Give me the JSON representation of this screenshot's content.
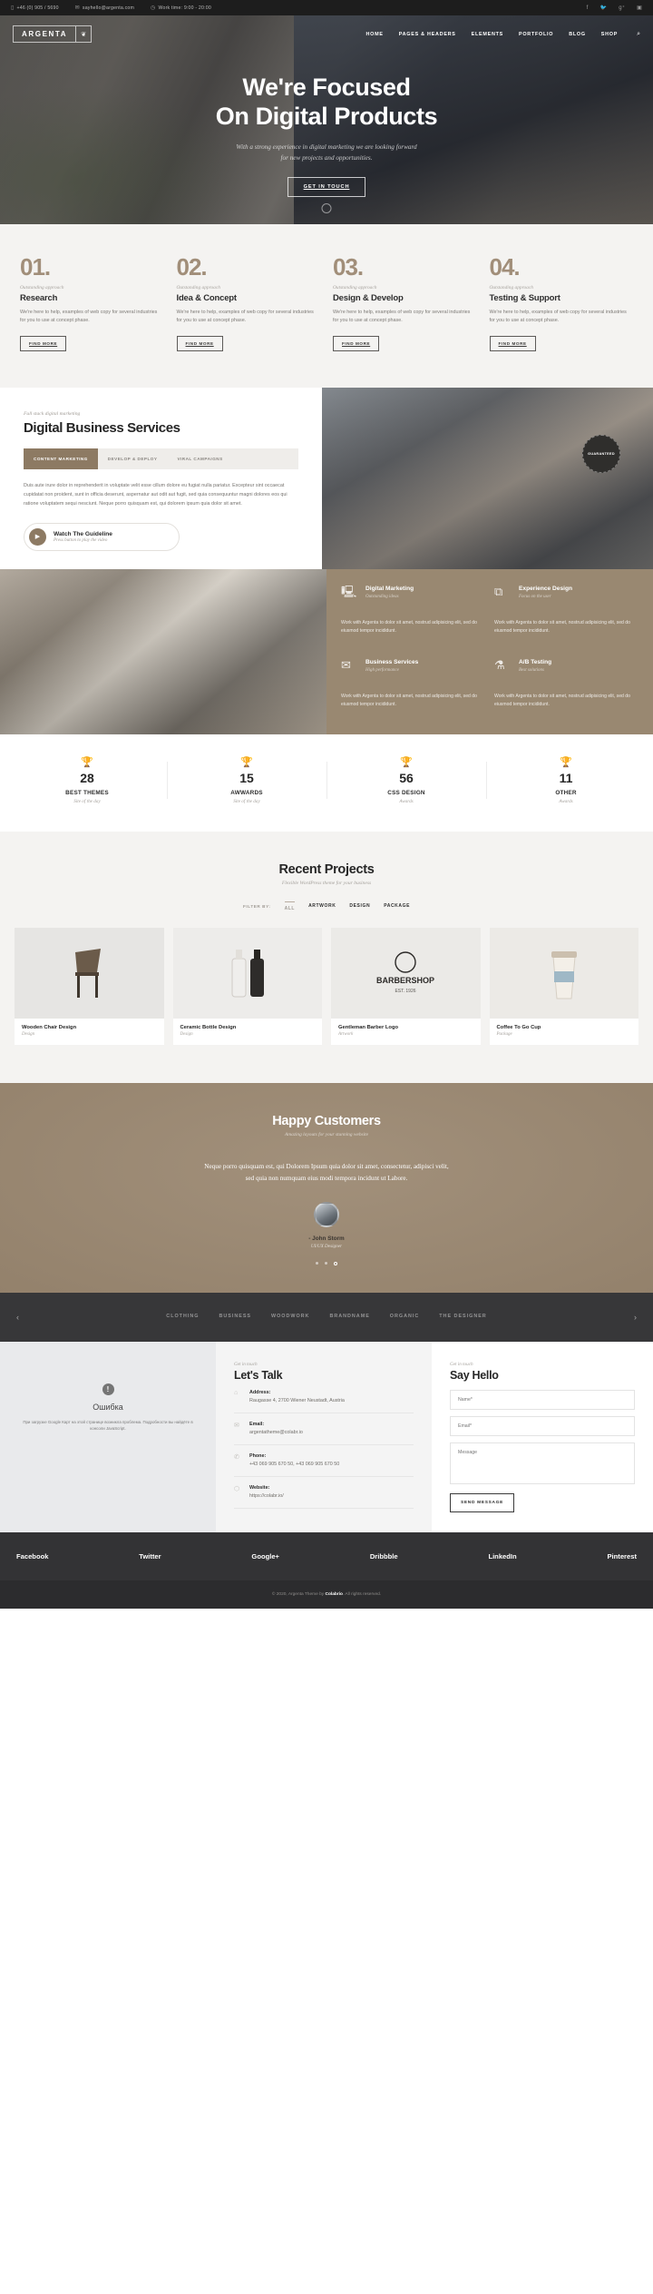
{
  "topbar": {
    "phone": "+46 (0) 905 / 5690",
    "email": "sayhello@argenta.com",
    "worktime": "Work time: 9:00 - 20:00",
    "socials": [
      "facebook-icon",
      "twitter-icon",
      "google-plus-icon",
      "instagram-icon"
    ]
  },
  "header": {
    "logo_text": "ARGENTA",
    "logo_mark": "leaf-icon",
    "nav": [
      "HOME",
      "PAGES & HEADERS",
      "ELEMENTS",
      "PORTFOLIO",
      "BLOG",
      "SHOP"
    ],
    "search_icon": "search-icon"
  },
  "hero": {
    "title_line1": "We're Focused",
    "title_line2": "On Digital Products",
    "subtitle_line1": "With a strong experience in digital marketing we are looking forward",
    "subtitle_line2": "for new projects and opportunities.",
    "cta": "GET IN TOUCH"
  },
  "steps": [
    {
      "num": "01.",
      "kicker": "Outstanding approach",
      "title": "Research",
      "text": "We're here to help, examples of web copy for several industries for you to use at concept phase.",
      "btn": "FIND MORE"
    },
    {
      "num": "02.",
      "kicker": "Outstanding approach",
      "title": "Idea & Concept",
      "text": "We're here to help, examples of web copy for several industries for you to use at concept phase.",
      "btn": "FIND MORE"
    },
    {
      "num": "03.",
      "kicker": "Outstanding approach",
      "title": "Design & Develop",
      "text": "We're here to help, examples of web copy for several industries for you to use at concept phase.",
      "btn": "FIND MORE"
    },
    {
      "num": "04.",
      "kicker": "Outstanding approach",
      "title": "Testing & Support",
      "text": "We're here to help, examples of web copy for several industries for you to use at concept phase.",
      "btn": "FIND MORE"
    }
  ],
  "services": {
    "kicker": "Full stack digital marketing",
    "heading": "Digital Business Services",
    "tabs": [
      "CONTENT MARKETING",
      "DEVELOP & DEPLOY",
      "VIRAL CAMPAIGNS"
    ],
    "active_tab": "CONTENT MARKETING",
    "paragraph": "Duis aute irure dolor in reprehenderit in voluptate velit esse cillum dolore eu fugiat nulla pariatur. Excepteur sint occaecat cupidatat non proident, sunt in officia deserunt, aspernatur aut odit aut fugit, sed quia consequuntur magni dolores eos qui ratione voluptatem sequi nesciunt. Neque porro quisquam est, qui dolorem ipsum quia dolor sit amet.",
    "watch_title": "Watch The Guideline",
    "watch_sub": "Press button to play the video",
    "badge": "GUARANTEED"
  },
  "features": [
    {
      "icon": "server-icon",
      "title": "Digital Marketing",
      "kicker": "Outstanding ideas",
      "text": "Work with Argenta to dolor sit amet, nostrud adipisicing elit, sed do eiusmod tempor incididunt."
    },
    {
      "icon": "frame-icon",
      "title": "Experience Design",
      "kicker": "Focus on the user",
      "text": "Work with Argenta to dolor sit amet, nostrud adipisicing elit, sed do eiusmod tempor incididunt."
    },
    {
      "icon": "envelope-icon",
      "title": "Business Services",
      "kicker": "High performance",
      "text": "Work with Argenta to dolor sit amet, nostrud adipisicing elit, sed do eiusmod tempor incididunt."
    },
    {
      "icon": "flask-icon",
      "title": "A/B Testing",
      "kicker": "Best solutions",
      "text": "Work with Argenta to dolor sit amet, nostrud adipisicing elit, sed do eiusmod tempor incididunt."
    }
  ],
  "counters": [
    {
      "icon": "trophy-icon",
      "number": "28",
      "label": "BEST THEMES",
      "sub": "Site of the day"
    },
    {
      "icon": "trophy-icon",
      "number": "15",
      "label": "AWWARDS",
      "sub": "Site of the day"
    },
    {
      "icon": "trophy-icon",
      "number": "56",
      "label": "CSS DESIGN",
      "sub": "Awards"
    },
    {
      "icon": "trophy-icon",
      "number": "11",
      "label": "OTHER",
      "sub": "Awards"
    }
  ],
  "projects": {
    "heading": "Recent Projects",
    "subtitle": "Flexible WordPress theme for your business",
    "filter_label": "FILTER BY:",
    "filters": [
      "ALL",
      "ARTWORK",
      "DESIGN",
      "PACKAGE"
    ],
    "active_filter": "ALL",
    "items": [
      {
        "title": "Wooden Chair Design",
        "category": "Design",
        "thumb": "chair-image"
      },
      {
        "title": "Ceramic Bottle Design",
        "category": "Design",
        "thumb": "bottles-image"
      },
      {
        "title": "Gentleman Barber Logo",
        "category": "Artwork",
        "thumb": "barbershop-logo-image"
      },
      {
        "title": "Coffee To Go Cup",
        "category": "Package",
        "thumb": "coffee-cup-image"
      }
    ]
  },
  "testimonials": {
    "heading": "Happy Customers",
    "subtitle": "Amazing layouts for your stunning website",
    "quote_line1": "Neque porro quisquam est, qui Dolorem Ipsum quia dolor sit amet, consectetur, adipisci velit,",
    "quote_line2": "sed quia non numquam eius modi tempora incidunt ut Labore.",
    "author": "- John Storm",
    "role": "UI/UX Designer",
    "slides": 3,
    "active_slide": 3
  },
  "clients": {
    "prev_icon": "chevron-left-icon",
    "next_icon": "chevron-right-icon",
    "logos": [
      "CLOTHING",
      "BUSINESS",
      "WOODWORK",
      "BRANDNAME",
      "ORGANIC",
      "THE DESIGNER"
    ]
  },
  "contact": {
    "map_error_icon": "warning-icon",
    "map_error_title": "Ошибка",
    "map_error_text": "При загрузке Google Карт на этой странице возникла проблема. Подробности вы найдёте в консоли JavaScript.",
    "left_kicker": "Get in touch",
    "left_heading": "Let's Talk",
    "info": [
      {
        "icon": "home-icon",
        "label": "Address:",
        "value": "Raugasse 4, 2700 Wiener Neustadt, Austria"
      },
      {
        "icon": "envelope-icon",
        "label": "Email:",
        "value": "argentatheme@colabr.io"
      },
      {
        "icon": "phone-icon",
        "label": "Phone:",
        "value": "+43 069 905 670 50, +43 069 905 670 50"
      },
      {
        "icon": "globe-icon",
        "label": "Website:",
        "value": "https://colabr.io/"
      }
    ],
    "right_kicker": "Get in touch",
    "right_heading": "Say Hello",
    "name_placeholder": "Name*",
    "email_placeholder": "Email*",
    "message_placeholder": "Message",
    "send_label": "SEND MESSAGE"
  },
  "footer": {
    "socials": [
      "Facebook",
      "Twitter",
      "Google+",
      "Dribbble",
      "LinkedIn",
      "Pinterest"
    ],
    "copyright_pre": "© 2020, Argenta Theme by ",
    "copyright_brand": "Colabrio",
    "copyright_post": ". All rights reserved."
  },
  "colors": {
    "accent": "#998871",
    "dark": "#2c2c2e",
    "light": "#f4f3f1"
  }
}
